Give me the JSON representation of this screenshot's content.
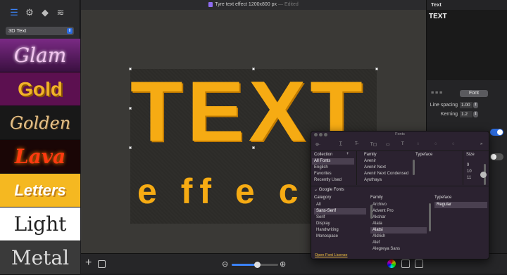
{
  "window_title": "Tyre text effect 1200x800 px",
  "window_status": "Edited",
  "sidebar": {
    "tools": [
      {
        "icon": "presets-icon",
        "glyph": "☰",
        "active": true
      },
      {
        "icon": "adjust-icon",
        "glyph": "⚙",
        "active": false
      },
      {
        "icon": "shapes-icon",
        "glyph": "◆",
        "active": false
      },
      {
        "icon": "layers-icon",
        "glyph": "≋",
        "active": false
      }
    ],
    "preset_category": "3D Text",
    "presets": [
      "Glam",
      "Gold",
      "Golden",
      "Lava",
      "Letters",
      "Light",
      "Metal"
    ]
  },
  "canvas": {
    "main_text": "TEXT",
    "sub_text": "e ff e c"
  },
  "inspector": {
    "title": "Text",
    "text_value": "TEXT",
    "align_glyphs": "≡ ≡ ≡",
    "font_button": "Font",
    "line_spacing_label": "Line spacing",
    "line_spacing_value": "1.00",
    "kerning_label": "Kerning",
    "kerning_value": "1.2"
  },
  "fonts_panel": {
    "title": "Fonts",
    "collection_header": "Collection",
    "add_glyph": "+",
    "collections": [
      "All Fonts",
      "English",
      "Favorites",
      "Recently Used"
    ],
    "family_header": "Family",
    "families_top": [
      "Avenir",
      "Avenir Next",
      "Avenir Next Condensed",
      "Ayuthaya"
    ],
    "typeface_header": "Typeface",
    "size_header": "Size",
    "sizes": [
      "9",
      "10",
      "11"
    ],
    "google_fonts_label": "Google Fonts",
    "category_header": "Category",
    "categories": [
      "All",
      "Sans-Serif",
      "Serif",
      "Display",
      "Handwriting",
      "Monospace"
    ],
    "family_header_2": "Family",
    "families_google": [
      "Archivo",
      "Advent Pro",
      "Akshar",
      "Alata",
      "Alatsi",
      "Aldrich",
      "Alef",
      "Alegreya Sans"
    ],
    "typeface_header_2": "Typeface",
    "typefaces": [
      "Regular"
    ],
    "open_license": "Open Font License"
  },
  "bottom": {
    "add_glyph": "+",
    "zoom_out_glyph": "⊖",
    "zoom_in_glyph": "⊕",
    "zoom_fraction": 0.55
  },
  "colors": {
    "accent": "#2d6cdf",
    "text_effect": "#f6ab13",
    "license_link": "#f0c040"
  }
}
